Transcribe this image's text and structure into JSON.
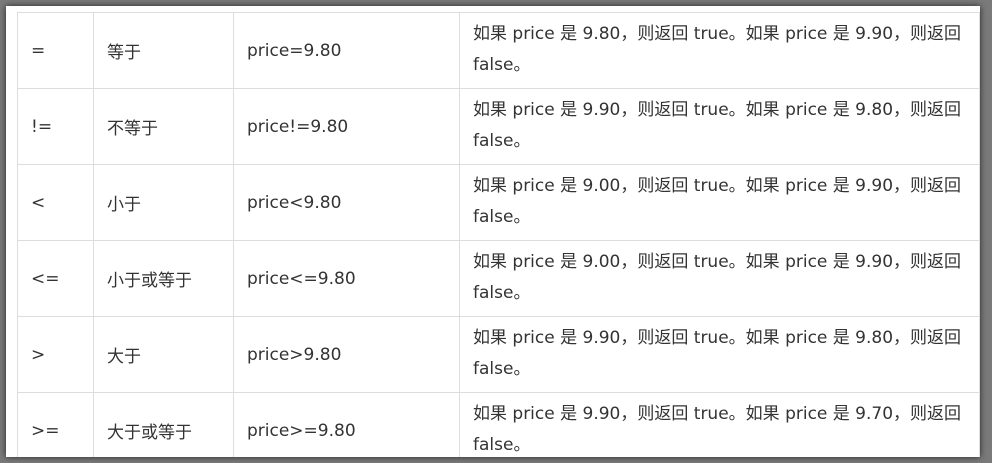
{
  "rows": [
    {
      "op": "=",
      "desc": "等于",
      "example": "price=9.80",
      "result": "如果 price 是 9.80，则返回 true。如果 price 是 9.90，则返回 false。"
    },
    {
      "op": "!=",
      "desc": "不等于",
      "example": "price!=9.80",
      "result": "如果 price 是 9.90，则返回 true。如果 price 是 9.80，则返回 false。"
    },
    {
      "op": "<",
      "desc": "小于",
      "example": "price<9.80",
      "result": "如果 price 是 9.00，则返回 true。如果 price 是 9.90，则返回 false。"
    },
    {
      "op": "<=",
      "desc": "小于或等于",
      "example": "price<=9.80",
      "result": "如果 price 是 9.00，则返回 true。如果 price 是 9.90，则返回 false。"
    },
    {
      "op": ">",
      "desc": "大于",
      "example": "price>9.80",
      "result": "如果 price 是 9.90，则返回 true。如果 price 是 9.80，则返回 false。"
    },
    {
      "op": ">=",
      "desc": "大于或等于",
      "example": "price>=9.80",
      "result": "如果 price 是 9.90，则返回 true。如果 price 是 9.70，则返回 false。"
    }
  ]
}
